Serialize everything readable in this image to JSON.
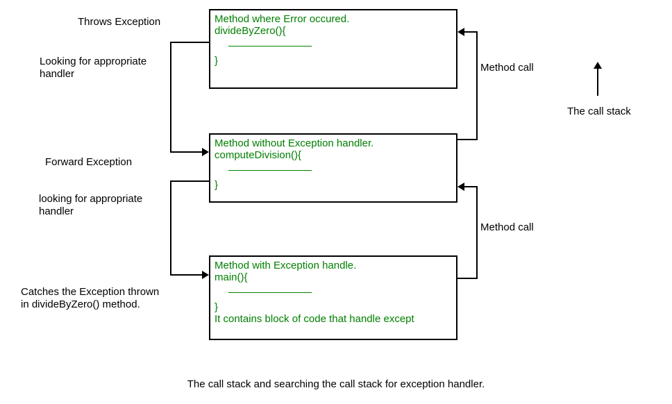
{
  "labels": {
    "throws": "Throws Exception",
    "looking1a": "Looking for appropriate",
    "looking1b": "handler",
    "forward": "Forward Exception",
    "looking2a": "looking for appropriate",
    "looking2b": "handler",
    "catches1": "Catches the Exception thrown",
    "catches2": "in divideByZero() method.",
    "methodcall1": "Method call",
    "methodcall2": "Method call",
    "callstack": "The call stack"
  },
  "boxes": {
    "box1": {
      "line1": "Method where Error occured.",
      "line2": "divideByZero(){",
      "line3": "}"
    },
    "box2": {
      "line1": "Method without Exception handler.",
      "line2": "computeDivision(){",
      "line3": "}"
    },
    "box3": {
      "line1": "Method with Exception handle.",
      "line2": "main(){",
      "line3": "}",
      "line4": "It contains block of code that handle except"
    }
  },
  "caption": "The call stack and searching the call stack for exception handler."
}
